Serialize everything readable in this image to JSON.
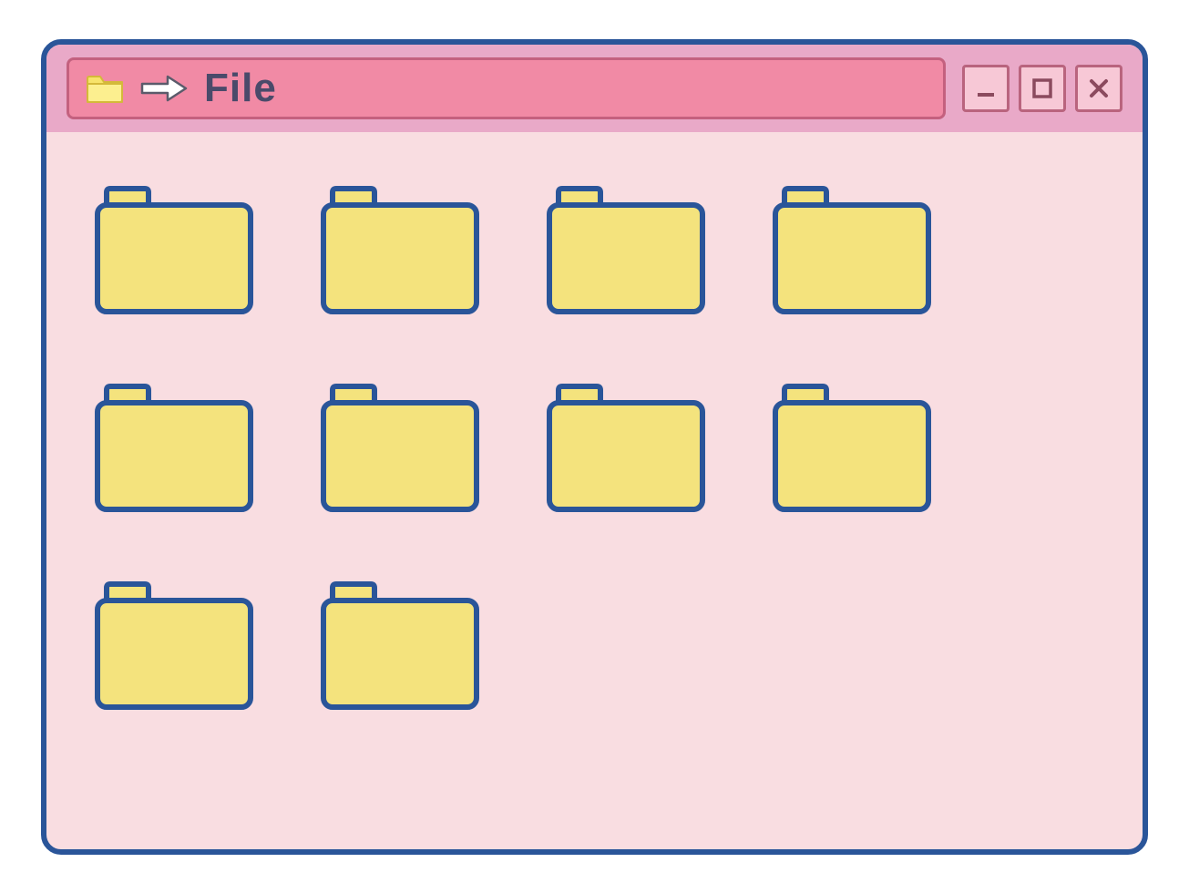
{
  "window": {
    "title": "File"
  },
  "icons": {
    "folder_small": "folder-icon",
    "arrow": "arrow-right-icon",
    "minimize": "minimize-icon",
    "maximize": "maximize-icon",
    "close": "close-icon"
  },
  "colors": {
    "border": "#2a5599",
    "content_bg": "#f9dde1",
    "titlebar_bg": "#e9a9c8",
    "title_pill_bg": "#f18aa5",
    "title_pill_border": "#c4617f",
    "folder_fill": "#f4e37d",
    "folder_stroke": "#2a5599",
    "button_bg": "#f7c8d6",
    "button_border": "#b9647e",
    "title_text": "#4a4a6a"
  },
  "folders": [
    {
      "name": "folder-1"
    },
    {
      "name": "folder-2"
    },
    {
      "name": "folder-3"
    },
    {
      "name": "folder-4"
    },
    {
      "name": "folder-5"
    },
    {
      "name": "folder-6"
    },
    {
      "name": "folder-7"
    },
    {
      "name": "folder-8"
    },
    {
      "name": "folder-9"
    },
    {
      "name": "folder-10"
    }
  ]
}
